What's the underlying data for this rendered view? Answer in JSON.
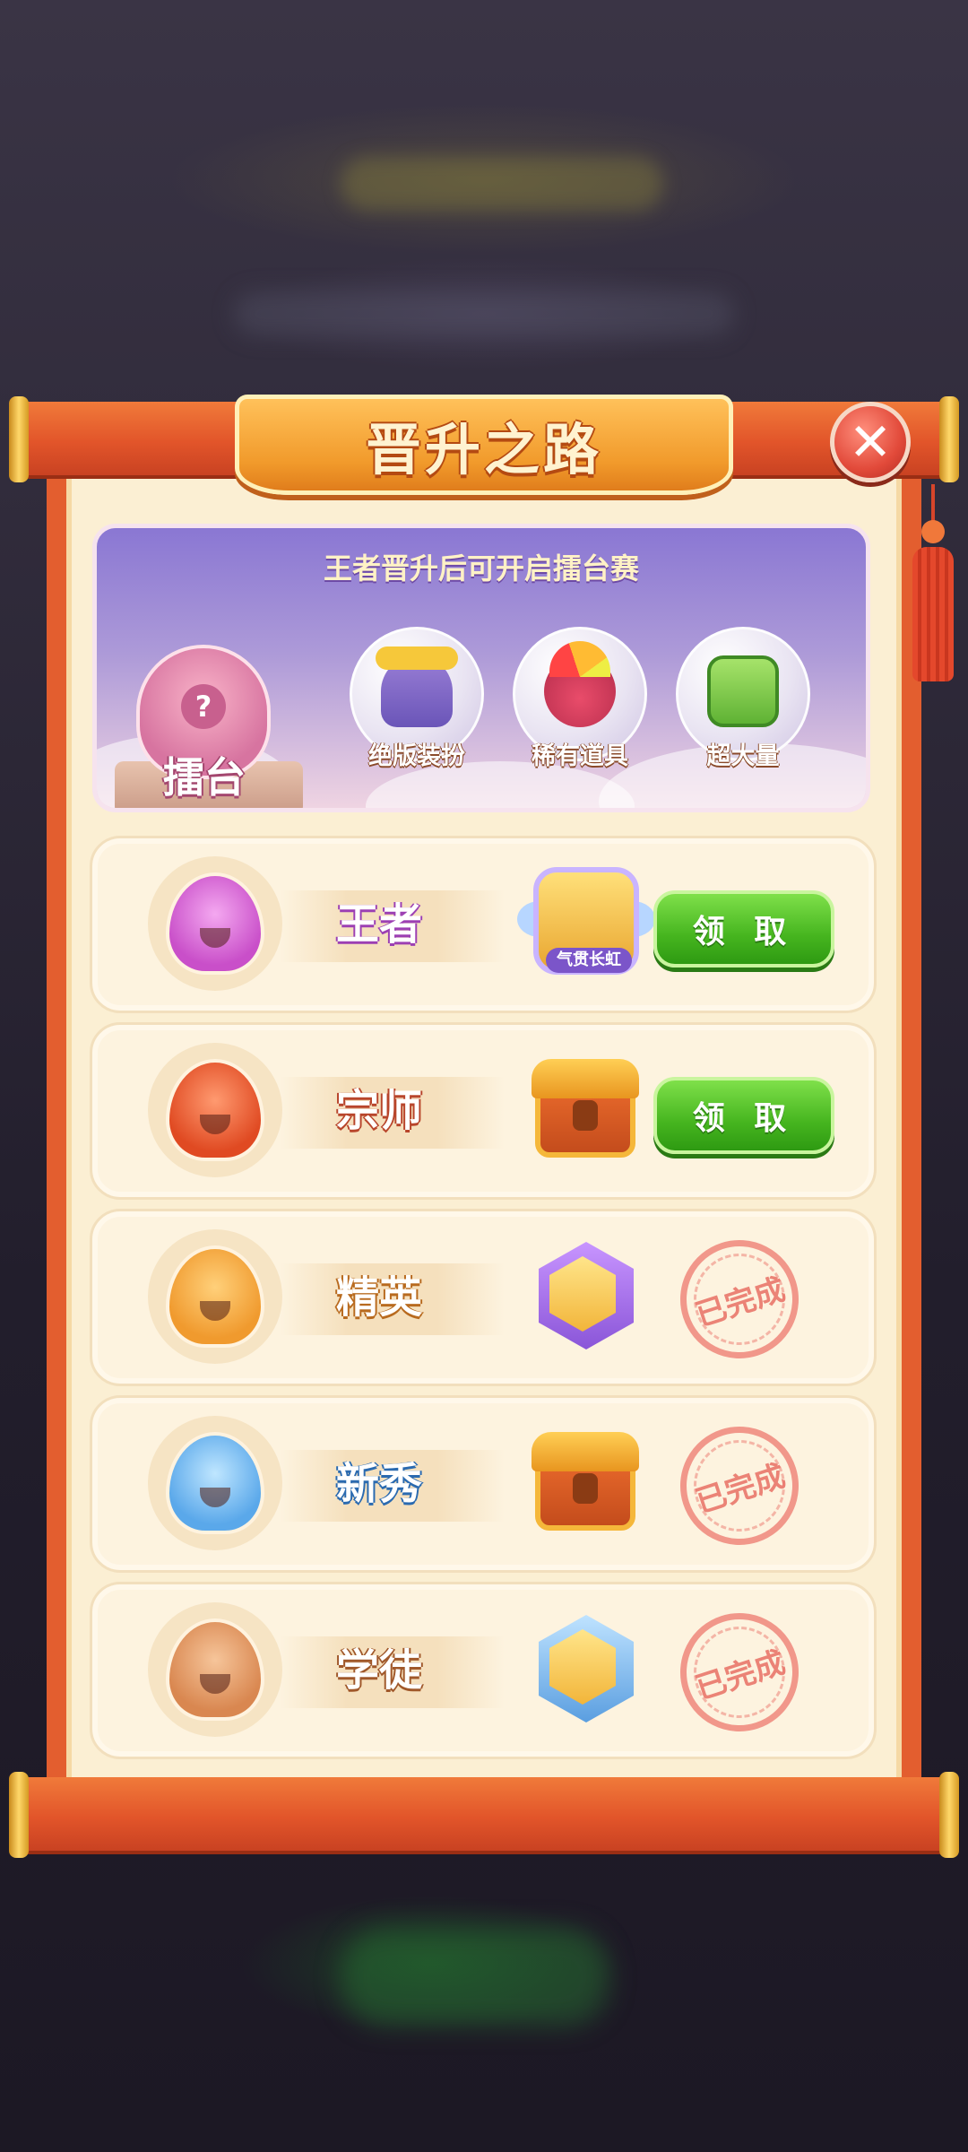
{
  "title": "晋升之路",
  "arena": {
    "title": "王者晋升后可开启擂台赛",
    "podium_label": "擂台",
    "podium_symbol": "?",
    "rewards": [
      {
        "label": "绝版装扮",
        "icon": "outfit-icon"
      },
      {
        "label": "稀有道具",
        "icon": "rare-item-icon"
      },
      {
        "label": "超大量",
        "icon": "bulk-pack-icon"
      }
    ]
  },
  "ranks": [
    {
      "name": "王者",
      "prize_icon": "crest-badge-icon",
      "prize_tag": "气贯长虹",
      "status": "claim",
      "action_label": "领 取",
      "color": "#d66bd6",
      "name_shadow": "#9c3fb3"
    },
    {
      "name": "宗师",
      "prize_icon": "treasure-chest-icon",
      "status": "claim",
      "action_label": "领 取",
      "color": "#e9532e",
      "name_shadow": "#b8452b"
    },
    {
      "name": "精英",
      "prize_icon": "hex-badge-icon",
      "status": "done",
      "action_label": "已完成",
      "color": "#f3a13a",
      "name_shadow": "#b86a1e"
    },
    {
      "name": "新秀",
      "prize_icon": "treasure-chest-icon",
      "status": "done",
      "action_label": "已完成",
      "color": "#6bb6ee",
      "name_shadow": "#2a6ab0"
    },
    {
      "name": "学徒",
      "prize_icon": "hex-badge-icon",
      "status": "done",
      "action_label": "已完成",
      "color": "#e0945f",
      "name_shadow": "#a0582a"
    }
  ],
  "colors": {
    "scroll_red": "#e35e2f",
    "paper": "#fbefd3",
    "claim_green": "#46b51f"
  }
}
